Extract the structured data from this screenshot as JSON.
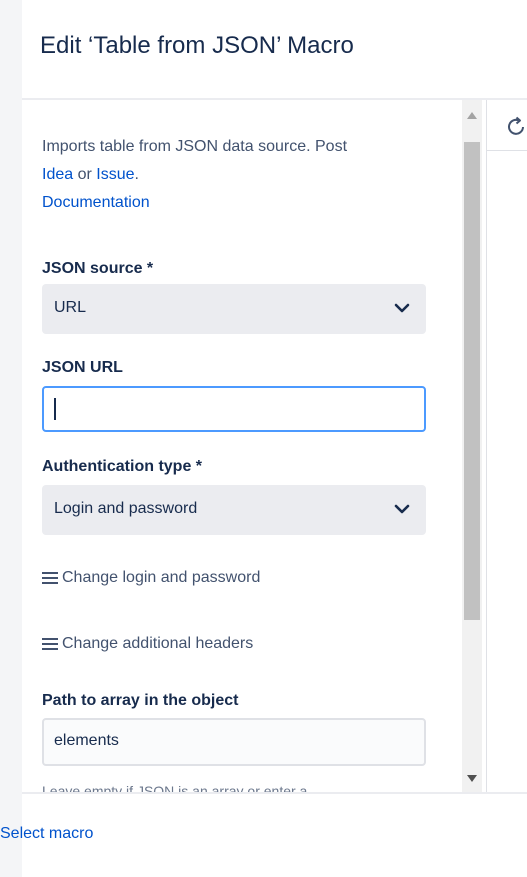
{
  "dialog": {
    "title": "Edit ‘Table from JSON’ Macro"
  },
  "form": {
    "description": {
      "text_before": "Imports table from JSON data source. Post ",
      "idea_link": "Idea",
      "text_middle": " or ",
      "issue_link": "Issue",
      "text_after": ".",
      "documentation_link": "Documentation"
    },
    "json_source": {
      "label": "JSON source *",
      "value": "URL"
    },
    "json_url": {
      "label": "JSON URL",
      "value": ""
    },
    "auth_type": {
      "label": "Authentication type *",
      "value": "Login and password"
    },
    "change_login_link": "Change login and password",
    "change_headers_link": "Change additional headers",
    "path_to_array": {
      "label": "Path to array in the object",
      "value": "elements",
      "helper": "Leave empty if JSON is an array or enter a"
    }
  },
  "footer": {
    "select_macro_link": "Select macro"
  },
  "icons": {
    "select_chevron": "chevron-down-icon",
    "link_prefix": "menu-icon",
    "preview_refresh": "refresh-icon"
  },
  "colors": {
    "link": "#0052cc",
    "focus_border": "#4c9aff",
    "select_bg": "#ebecf0"
  }
}
